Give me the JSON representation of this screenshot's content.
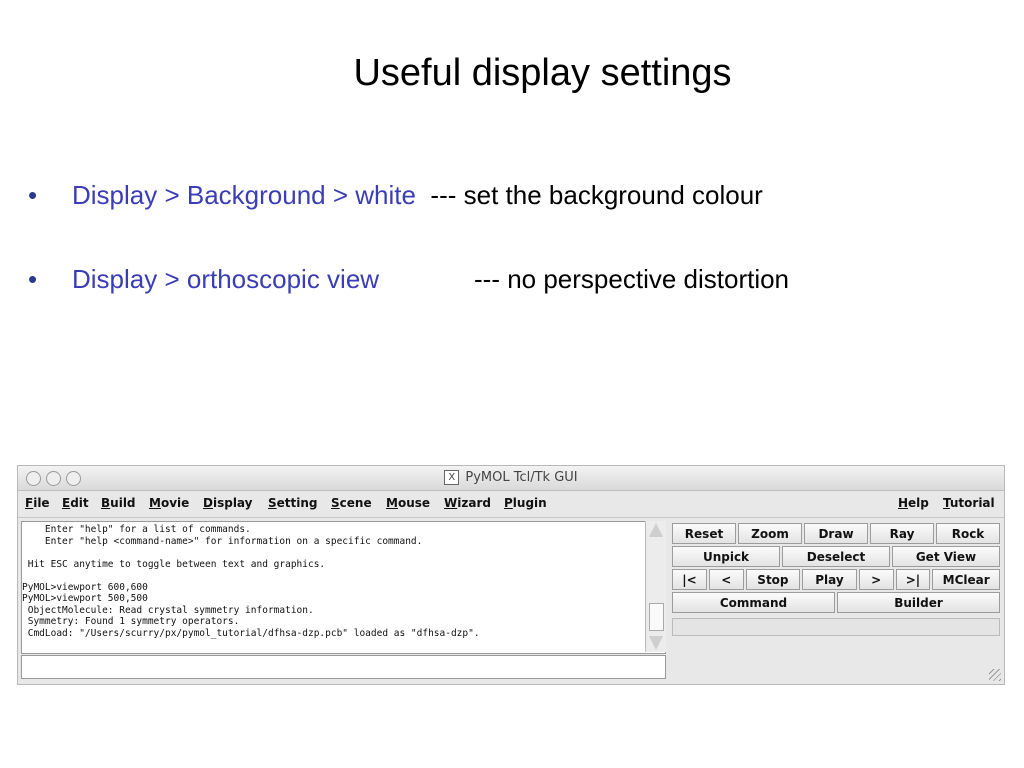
{
  "slide": {
    "title": "Useful display settings",
    "bullets": [
      {
        "bullet": "•",
        "link": "Display > Background > white",
        "desc": "--- set the background colour"
      },
      {
        "bullet": "•",
        "link": "Display > orthoscopic view",
        "desc": "--- no perspective distortion"
      }
    ]
  },
  "window": {
    "title": "PyMOL Tcl/Tk GUI",
    "x_icon": "X",
    "menu": [
      "File",
      "Edit",
      "Build",
      "Movie",
      "Display",
      "Setting",
      "Scene",
      "Mouse",
      "Wizard",
      "Plugin"
    ],
    "menu_right": [
      "Help",
      "Tutorial"
    ],
    "console_lines": [
      "    Enter \"help\" for a list of commands.",
      "    Enter \"help <command-name>\" for information on a specific command.",
      "",
      " Hit ESC anytime to toggle between text and graphics.",
      "",
      "PyMOL>viewport 600,600",
      "PyMOL>viewport 500,500",
      " ObjectMolecule: Read crystal symmetry information.",
      " Symmetry: Found 1 symmetry operators.",
      " CmdLoad: \"/Users/scurry/px/pymol_tutorial/dfhsa-dzp.pcb\" loaded as \"dfhsa-dzp\"."
    ],
    "command_input": "",
    "buttons_row1": [
      "Reset",
      "Zoom",
      "Draw",
      "Ray",
      "Rock"
    ],
    "buttons_row2": [
      "Unpick",
      "Deselect",
      "Get View"
    ],
    "buttons_row3": [
      "|<",
      "<",
      "Stop",
      "Play",
      ">",
      ">|",
      "MClear"
    ],
    "buttons_row4": [
      "Command",
      "Builder"
    ]
  }
}
